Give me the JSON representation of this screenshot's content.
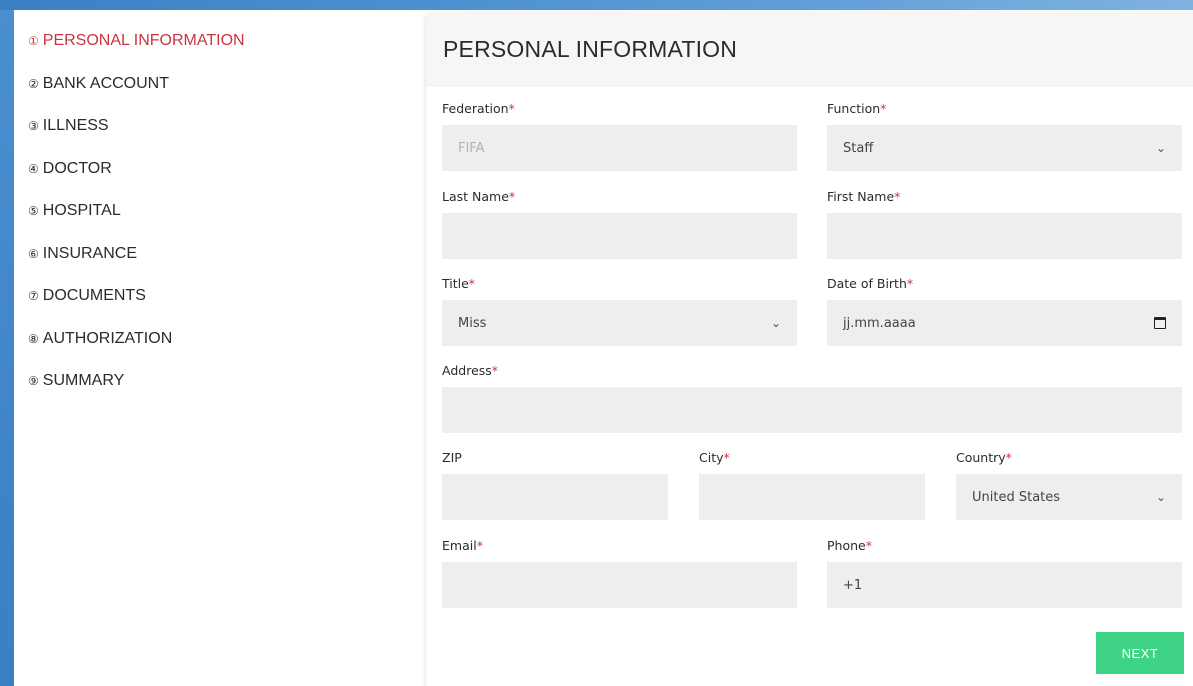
{
  "steps": [
    {
      "num": "①",
      "label": "PERSONAL INFORMATION"
    },
    {
      "num": "②",
      "label": "BANK ACCOUNT"
    },
    {
      "num": "③",
      "label": "ILLNESS"
    },
    {
      "num": "④",
      "label": "DOCTOR"
    },
    {
      "num": "⑤",
      "label": "HOSPITAL"
    },
    {
      "num": "⑥",
      "label": "INSURANCE"
    },
    {
      "num": "⑦",
      "label": "DOCUMENTS"
    },
    {
      "num": "⑧",
      "label": "AUTHORIZATION"
    },
    {
      "num": "⑨",
      "label": "SUMMARY"
    }
  ],
  "active_step": 0,
  "form": {
    "title": "PERSONAL INFORMATION",
    "required_mark": "*",
    "federation": {
      "label": "Federation",
      "value": "FIFA"
    },
    "function": {
      "label": "Function",
      "value": "Staff"
    },
    "last_name": {
      "label": "Last Name",
      "value": ""
    },
    "first_name": {
      "label": "First Name",
      "value": ""
    },
    "title_field": {
      "label": "Title",
      "value": "Miss"
    },
    "dob": {
      "label": "Date of Birth",
      "placeholder": "jj.mm.aaaa"
    },
    "address": {
      "label": "Address",
      "value": ""
    },
    "zip": {
      "label": "ZIP",
      "value": ""
    },
    "city": {
      "label": "City",
      "value": ""
    },
    "country": {
      "label": "Country",
      "value": "United States"
    },
    "email": {
      "label": "Email",
      "value": ""
    },
    "phone": {
      "label": "Phone",
      "value": "+1"
    },
    "next_label": "NEXT"
  },
  "colors": {
    "active_step": "#c9353f",
    "required": "#c9353f",
    "next_button": "#3fd485",
    "field_bg": "#eeeeee"
  },
  "icons": {
    "select": "chevron-down-icon",
    "date": "calendar-icon"
  }
}
